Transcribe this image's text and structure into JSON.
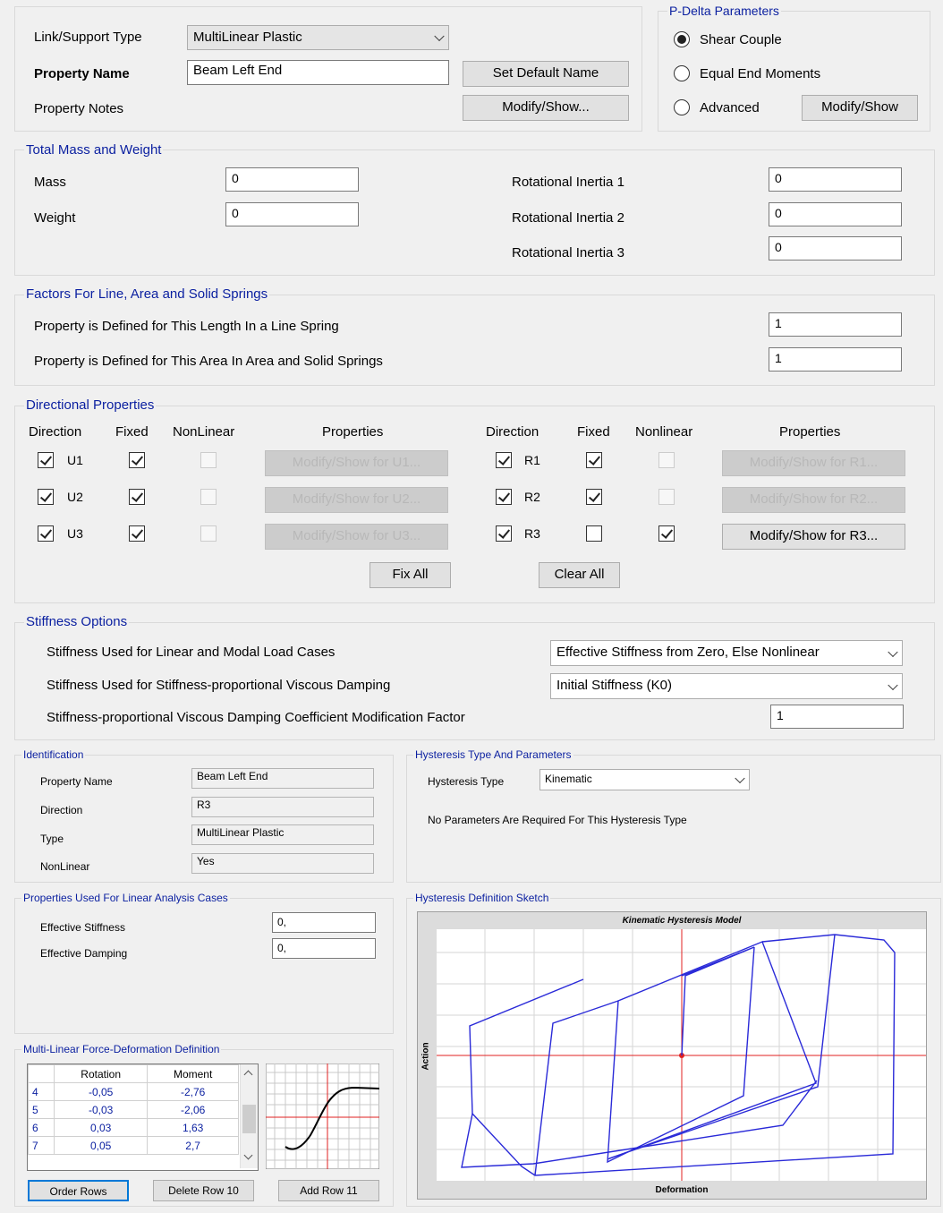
{
  "header": {
    "link_type_label": "Link/Support Type",
    "link_type_value": "MultiLinear Plastic",
    "property_name_label": "Property Name",
    "property_name_value": "Beam Left End",
    "set_default_name": "Set Default Name",
    "property_notes_label": "Property Notes",
    "modify_show": "Modify/Show..."
  },
  "pdelta": {
    "title": "P-Delta Parameters",
    "options": [
      "Shear Couple",
      "Equal End Moments",
      "Advanced"
    ],
    "selected": "Shear Couple",
    "modify_show": "Modify/Show"
  },
  "mass": {
    "title": "Total Mass and Weight",
    "mass_label": "Mass",
    "mass_value": "0",
    "weight_label": "Weight",
    "weight_value": "0",
    "rot1_label": "Rotational Inertia 1",
    "rot1_value": "0",
    "rot2_label": "Rotational Inertia 2",
    "rot2_value": "0",
    "rot3_label": "Rotational Inertia 3",
    "rot3_value": "0"
  },
  "factors": {
    "title": "Factors For Line, Area and Solid Springs",
    "line_label": "Property is Defined for This Length In a Line Spring",
    "line_value": "1",
    "area_label": "Property is Defined for This Area In Area and Solid Springs",
    "area_value": "1"
  },
  "directional": {
    "title": "Directional Properties",
    "left_headers": [
      "Direction",
      "Fixed",
      "NonLinear",
      "Properties"
    ],
    "right_headers": [
      "Direction",
      "Fixed",
      "Nonlinear",
      "Properties"
    ],
    "rows": [
      {
        "dir": "U1",
        "btn": "Modify/Show for U1..."
      },
      {
        "dir": "U2",
        "btn": "Modify/Show for U2..."
      },
      {
        "dir": "U3",
        "btn": "Modify/Show for U3..."
      },
      {
        "dir": "R1",
        "btn": "Modify/Show for R1..."
      },
      {
        "dir": "R2",
        "btn": "Modify/Show for R2..."
      },
      {
        "dir": "R3",
        "btn": "Modify/Show for R3..."
      }
    ],
    "fix_all": "Fix All",
    "clear_all": "Clear All"
  },
  "stiffness": {
    "title": "Stiffness Options",
    "linear_label": "Stiffness Used for Linear and Modal Load Cases",
    "linear_value": "Effective Stiffness from Zero, Else Nonlinear",
    "damping_label": "Stiffness Used for Stiffness-proportional Viscous Damping",
    "damping_value": "Initial Stiffness (K0)",
    "factor_label": "Stiffness-proportional Viscous Damping Coefficient Modification Factor",
    "factor_value": "1"
  },
  "identification": {
    "title": "Identification",
    "property_name_label": "Property Name",
    "property_name_value": "Beam Left End",
    "direction_label": "Direction",
    "direction_value": "R3",
    "type_label": "Type",
    "type_value": "MultiLinear Plastic",
    "nonlinear_label": "NonLinear",
    "nonlinear_value": "Yes"
  },
  "hysteresis": {
    "title": "Hysteresis Type And Parameters",
    "type_label": "Hysteresis Type",
    "type_value": "Kinematic",
    "note": "No Parameters Are Required For This Hysteresis Type"
  },
  "linear": {
    "title": "Properties Used For Linear Analysis Cases",
    "eff_stiff_label": "Effective Stiffness",
    "eff_stiff_value": "0,",
    "eff_damp_label": "Effective Damping",
    "eff_damp_value": "0,"
  },
  "multilinear": {
    "title": "Multi-Linear Force-Deformation Definition",
    "col_rotation": "Rotation",
    "col_moment": "Moment",
    "rows": [
      {
        "n": "4",
        "rotation": "-0,05",
        "moment": "-2,76"
      },
      {
        "n": "5",
        "rotation": "-0,03",
        "moment": "-2,06"
      },
      {
        "n": "6",
        "rotation": "0,03",
        "moment": "1,63"
      },
      {
        "n": "7",
        "rotation": "0,05",
        "moment": "2,7"
      }
    ],
    "order_rows": "Order Rows",
    "delete_row": "Delete Row 10",
    "add_row": "Add Row 11"
  },
  "sketch": {
    "title": "Hysteresis Definition Sketch",
    "plot_title": "Kinematic Hysteresis Model",
    "xlabel": "Deformation",
    "ylabel": "Action"
  }
}
